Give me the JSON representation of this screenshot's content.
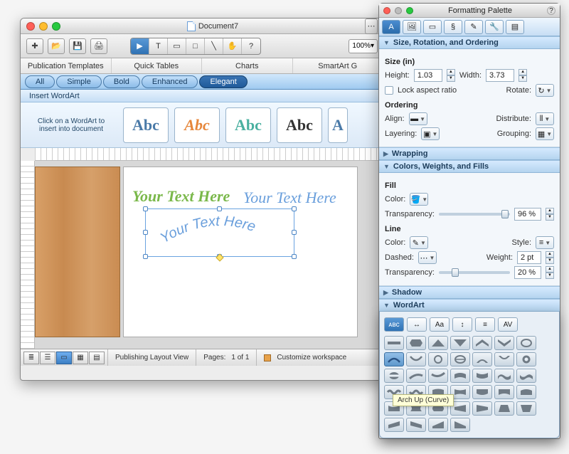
{
  "document": {
    "title": "Document7",
    "zoom": "100%"
  },
  "tabs": {
    "items": [
      "Publication Templates",
      "Quick Tables",
      "Charts",
      "SmartArt G"
    ]
  },
  "style_filter": {
    "items": [
      "All",
      "Simple",
      "Bold",
      "Enhanced",
      "Elegant"
    ],
    "active_index": 4
  },
  "wordart_gallery": {
    "title": "Insert WordArt",
    "hint": "Click on a WordArt to insert into document",
    "samples": [
      "Abc",
      "Abc",
      "Abc",
      "Abc",
      "A"
    ]
  },
  "canvas": {
    "wordart_preview_a": "Your Text Here",
    "wordart_preview_b": "Your Text Here",
    "selected_arch_text": "Your Text Here"
  },
  "statusbar": {
    "mode": "Publishing Layout View",
    "pages_label": "Pages:",
    "pages_value": "1 of 1",
    "customize_label": "Customize workspace"
  },
  "palette": {
    "title": "Formatting Palette",
    "sections": {
      "size": {
        "title": "Size, Rotation, and Ordering",
        "size_heading": "Size (in)",
        "height_label": "Height:",
        "height_value": "1.03",
        "width_label": "Width:",
        "width_value": "3.73",
        "lock_label": "Lock aspect ratio",
        "rotate_label": "Rotate:",
        "ordering_heading": "Ordering",
        "align_label": "Align:",
        "distribute_label": "Distribute:",
        "layering_label": "Layering:",
        "grouping_label": "Grouping:"
      },
      "wrapping": {
        "title": "Wrapping"
      },
      "colors": {
        "title": "Colors, Weights, and Fills",
        "fill_heading": "Fill",
        "color_label": "Color:",
        "transparency_label": "Transparency:",
        "fill_transparency_value": "96 %",
        "line_heading": "Line",
        "style_label": "Style:",
        "dashed_label": "Dashed:",
        "weight_label": "Weight:",
        "weight_value": "2 pt",
        "line_transparency_value": "20 %"
      },
      "shadow": {
        "title": "Shadow"
      },
      "wordart": {
        "title": "WordArt"
      }
    },
    "shape_tooltip": "Arch Up (Curve)"
  }
}
